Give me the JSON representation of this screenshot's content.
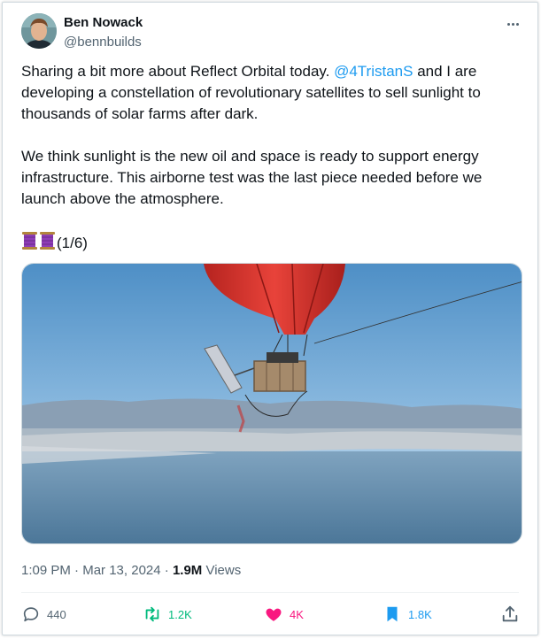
{
  "author": {
    "name": "Ben Nowack",
    "handle": "@bennbuilds"
  },
  "tweet": {
    "p1_a": "Sharing a bit more about Reflect Orbital today. ",
    "mention": "@4TristanS",
    "p1_b": " and I are developing a constellation of revolutionary satellites to sell sunlight to thousands of solar farms after dark.",
    "p2": "We think sunlight is the new oil and space is ready to support energy infrastructure. This airborne test was the last piece needed before we launch above the atmosphere.",
    "p3": "(1/6)"
  },
  "meta": {
    "time": "1:09 PM",
    "sep": " · ",
    "date": "Mar 13, 2024",
    "sep2": " · ",
    "views": "1.9M",
    "views_label": " Views"
  },
  "actions": {
    "replies": "440",
    "reposts": "1.2K",
    "likes": "4K",
    "bookmarks": "1.8K"
  },
  "colors": {
    "link": "#1d9bf0",
    "repost": "#00ba7c",
    "like": "#f91880",
    "bookmark": "#1d9bf0",
    "muted": "#536471"
  },
  "icons": {
    "reply": "reply-icon",
    "repost": "repost-icon",
    "like": "heart-icon",
    "bookmark": "bookmark-icon",
    "share": "share-icon",
    "more": "more-icon",
    "spool": "spool-emoji-icon"
  }
}
